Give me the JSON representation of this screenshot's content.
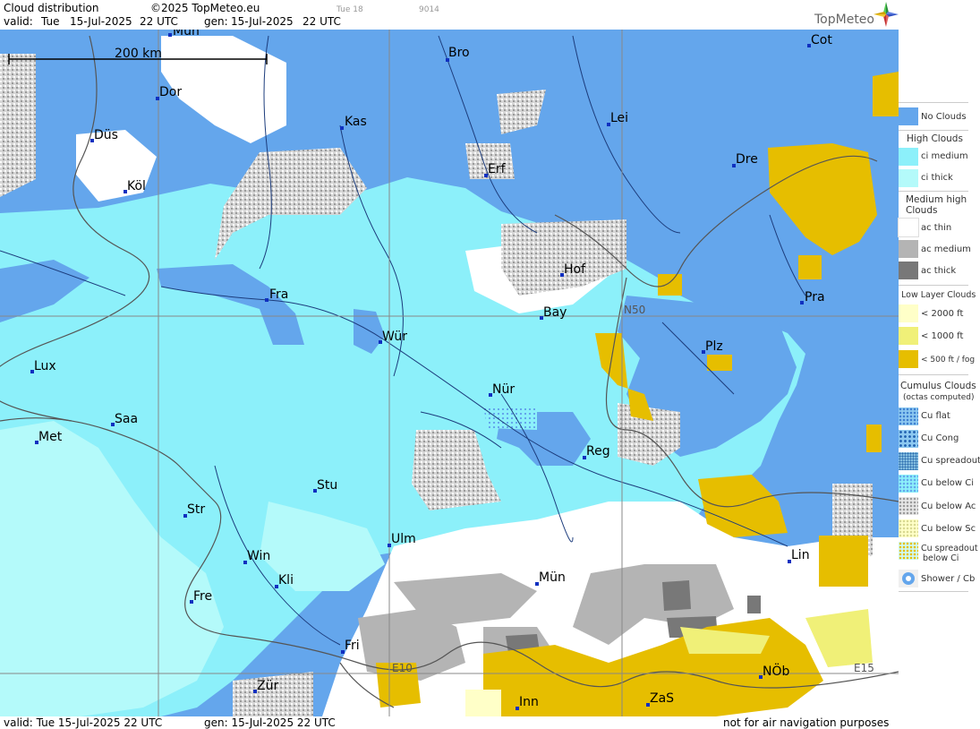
{
  "header": {
    "title": "Cloud distribution",
    "copyright": "©2025 TopMeteo.eu",
    "valid_label": "valid:",
    "valid_day": "Tue",
    "valid_date": "15-Jul-2025",
    "valid_time": "22 UTC",
    "gen_label": "gen:",
    "gen_date": "15-Jul-2025",
    "gen_time": "22 UTC",
    "tiny_a": "Tue 18",
    "tiny_b": "9014",
    "brand": "TopMeteo"
  },
  "footer": {
    "valid": "valid:  Tue  15-Jul-2025  22 UTC",
    "gen": "gen: 15-Jul-2025  22 UTC",
    "note": "not for air navigation purposes"
  },
  "map": {
    "scale_label": "200 km",
    "grid_labels": [
      "N50",
      "E10",
      "E15"
    ],
    "cities": [
      "Mün",
      "Bro",
      "Cot",
      "Dor",
      "Kas",
      "Lei",
      "Düs",
      "Erf",
      "Dre",
      "Köl",
      "Hof",
      "Pra",
      "Fra",
      "Bay",
      "Wür",
      "Plz",
      "Lux",
      "Nür",
      "Saa",
      "Met",
      "Reg",
      "Stu",
      "Str",
      "Ulm",
      "Win",
      "Lin",
      "Mün",
      "Kli",
      "Fre",
      "Fri",
      "NÖb",
      "Zür",
      "ZaS",
      "Inn"
    ]
  },
  "legend": {
    "no_clouds": "No Clouds",
    "high_header": "High Clouds",
    "ci_medium": "ci medium",
    "ci_thick": "ci thick",
    "medium_header": "Medium high Clouds",
    "ac_thin": "ac thin",
    "ac_medium": "ac medium",
    "ac_thick": "ac thick",
    "low_header": "Low Layer Clouds",
    "low_2000": "< 2000 ft",
    "low_1000": "< 1000 ft",
    "low_500": "< 500 ft / fog",
    "cumulus_header": "Cumulus Clouds",
    "cumulus_sub": "(octas computed)",
    "cu_flat": "Cu flat",
    "cu_cong": "Cu Cong",
    "cu_spreadout": "Cu spreadout",
    "cu_below_ci": "Cu below Ci",
    "cu_below_ac": "Cu below Ac",
    "cu_below_sc": "Cu below Sc",
    "cu_spreadout_ci_1": "Cu spreadout",
    "cu_spreadout_ci_2": "below Ci",
    "shower": "Shower / Cb"
  },
  "colors": {
    "no_clouds": "#64a6ec",
    "ci_medium": "#8cf0fa",
    "ci_thick": "#b4fafa",
    "ac_thin": "#ffffff",
    "ac_medium": "#b4b4b4",
    "ac_thick": "#787878",
    "low_2000": "#ffffc8",
    "low_1000": "#f0f078",
    "low_500": "#e6be00"
  }
}
